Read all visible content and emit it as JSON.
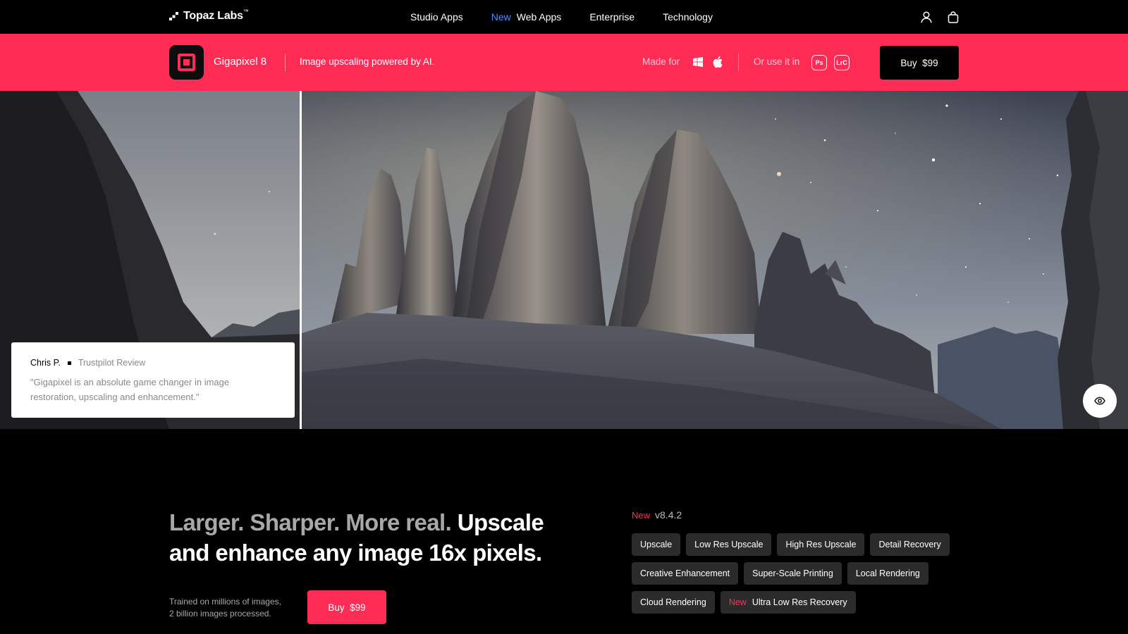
{
  "nav": {
    "logo_text": "Topaz Labs",
    "logo_mark": "™",
    "links": [
      {
        "label": "Studio Apps",
        "badge": ""
      },
      {
        "label": "Web Apps",
        "badge": "New"
      },
      {
        "label": "Enterprise",
        "badge": ""
      },
      {
        "label": "Technology",
        "badge": ""
      }
    ],
    "icons": [
      "user-icon",
      "shopping-bag-icon"
    ]
  },
  "product_bar": {
    "name": "Gigapixel 8",
    "tagline": "Image upscaling powered by AI.",
    "made_for_label": "Made for",
    "os_icons": [
      "windows-icon",
      "apple-icon"
    ],
    "use_in_label": "Or use it in",
    "plugins": [
      "Ps",
      "LrC"
    ],
    "buy_label": "Buy",
    "price": "$99",
    "accent_color": "#ff2d55"
  },
  "hero": {
    "review": {
      "author": "Chris P.",
      "source": "Trustpilot Review",
      "quote": "\"Gigapixel is an absolute game changer in image restoration, upscaling and enhancement.\""
    },
    "eye_button_icon": "eye-icon"
  },
  "main": {
    "headline_muted": "Larger. Sharper. More real.",
    "headline_bright": "Upscale and enhance any image 16x pixels.",
    "trained_line1": "Trained on millions of images,",
    "trained_line2": "2 billion images processed.",
    "buy_label": "Buy",
    "price": "$99",
    "version_badge": "New",
    "version": "v8.4.2",
    "features": [
      {
        "label": "Upscale",
        "badge": ""
      },
      {
        "label": "Low Res Upscale",
        "badge": ""
      },
      {
        "label": "High Res Upscale",
        "badge": ""
      },
      {
        "label": "Detail Recovery",
        "badge": ""
      },
      {
        "label": "Creative Enhancement",
        "badge": ""
      },
      {
        "label": "Super-Scale Printing",
        "badge": ""
      },
      {
        "label": "Local Rendering",
        "badge": ""
      },
      {
        "label": "Cloud Rendering",
        "badge": ""
      },
      {
        "label": "Ultra Low Res Recovery",
        "badge": "New"
      }
    ]
  }
}
